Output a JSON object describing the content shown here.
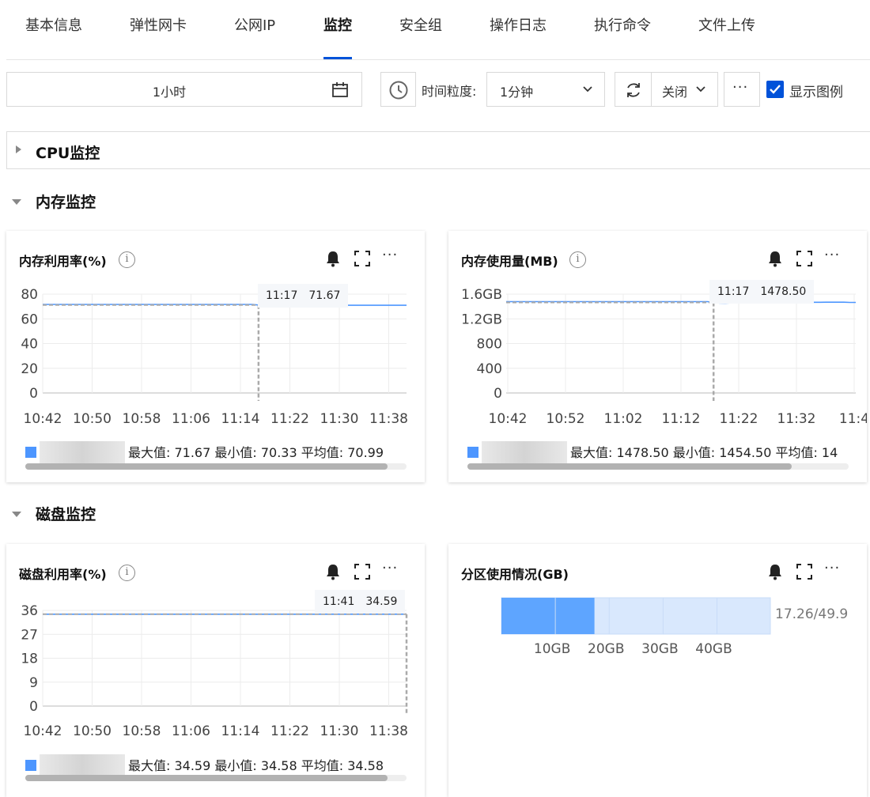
{
  "tabs": [
    {
      "label": "基本信息",
      "active": false
    },
    {
      "label": "弹性网卡",
      "active": false
    },
    {
      "label": "公网IP",
      "active": false
    },
    {
      "label": "监控",
      "active": true
    },
    {
      "label": "安全组",
      "active": false
    },
    {
      "label": "操作日志",
      "active": false
    },
    {
      "label": "执行命令",
      "active": false
    },
    {
      "label": "文件上传",
      "active": false
    }
  ],
  "toolbar": {
    "time_range": "1小时",
    "granularity_label": "时间粒度:",
    "granularity_value": "1分钟",
    "auto_refresh_value": "关闭",
    "more_label": "···",
    "show_legend_label": "显示图例",
    "show_legend_checked": true
  },
  "sections": {
    "cpu": {
      "title": "CPU监控",
      "expanded": false
    },
    "memory": {
      "title": "内存监控",
      "expanded": true
    },
    "disk": {
      "title": "磁盘监控",
      "expanded": true
    }
  },
  "colors": {
    "accent": "#0052d9",
    "series": "#4d96ff",
    "partition_fill": "#5ea5ff",
    "partition_bg": "#d9e8fd"
  },
  "cards": {
    "mem_util": {
      "title": "内存利用率(%)",
      "tooltip_time": "11:17",
      "tooltip_value": "71.67",
      "legend_stats": "最大值: 71.67 最小值: 70.33 平均值: 70.99",
      "scroll_fraction": 0.95
    },
    "mem_used": {
      "title": "内存使用量(MB)",
      "tooltip_time": "11:17",
      "tooltip_value": "1478.50",
      "legend_stats": "最大值: 1478.50 最小值: 1454.50 平均值: 14",
      "scroll_fraction": 0.85
    },
    "disk_util": {
      "title": "磁盘利用率(%)",
      "tooltip_time": "11:41",
      "tooltip_value": "34.59",
      "legend_stats": "最大值: 34.59 最小值: 34.58 平均值: 34.58",
      "scroll_fraction": 0.95
    },
    "partition": {
      "title": "分区使用情况(GB)",
      "used_label": "17.26/49.9"
    }
  },
  "chart_data": [
    {
      "id": "mem_util",
      "type": "line",
      "title": "内存利用率(%)",
      "ylim": [
        0,
        80
      ],
      "y_ticks": [
        "80",
        "60",
        "40",
        "20",
        "0"
      ],
      "x_ticks": [
        "10:42",
        "10:50",
        "10:58",
        "11:06",
        "11:14",
        "11:22",
        "11:30",
        "11:38"
      ],
      "series": [
        {
          "values": [
            71.67,
            71.67,
            71.67,
            71.67,
            71.67,
            71.67,
            71.67,
            71.67,
            71.67,
            71.67,
            71.67,
            71.67,
            71.67,
            71.67,
            71.67,
            71.67,
            71.67,
            71.67,
            71.67,
            71.67,
            71.67,
            71.67,
            71.67,
            71.67,
            71.67,
            71.67,
            71.67,
            71.67,
            71.67,
            71.67,
            71.67,
            71.67,
            71.67,
            71.67,
            71.67,
            71.2,
            70.5,
            70.33,
            70.8,
            71.0,
            71.0,
            70.9,
            71.0,
            71.0,
            70.95,
            71.0,
            71.0,
            70.9,
            71.0,
            71.0,
            71.0,
            70.95,
            71.0,
            71.0,
            71.0,
            71.0,
            71.0,
            71.0,
            71.0,
            71.0
          ]
        }
      ],
      "hover_index": 35,
      "grid": true
    },
    {
      "id": "mem_used",
      "type": "line",
      "title": "内存使用量(MB)",
      "ylim": [
        0,
        1600
      ],
      "y_ticks": [
        "1.6GB",
        "1.2GB",
        "800",
        "400",
        "0"
      ],
      "x_ticks": [
        "10:42",
        "10:52",
        "11:02",
        "11:12",
        "11:22",
        "11:32",
        "11:4"
      ],
      "series": [
        {
          "values": [
            1478.5,
            1478.5,
            1478.5,
            1478.5,
            1478.5,
            1478.5,
            1478.5,
            1478.5,
            1478.5,
            1478.5,
            1478.5,
            1478.5,
            1478.5,
            1478.5,
            1478.5,
            1478.5,
            1478.5,
            1478.5,
            1478.5,
            1478.5,
            1478.5,
            1478.5,
            1478.5,
            1478.5,
            1478.5,
            1478.5,
            1478.5,
            1478.5,
            1478.5,
            1478.5,
            1478.5,
            1478.5,
            1478.5,
            1478.5,
            1478.5,
            1465,
            1456,
            1454.5,
            1458,
            1460,
            1461,
            1462,
            1462,
            1463,
            1463,
            1464,
            1465,
            1466,
            1466,
            1467,
            1467,
            1468,
            1468,
            1468,
            1469,
            1469,
            1469,
            1469,
            1466,
            1465
          ]
        }
      ],
      "hover_index": 35,
      "grid": true
    },
    {
      "id": "disk_util",
      "type": "line",
      "title": "磁盘利用率(%)",
      "ylim": [
        0,
        36
      ],
      "y_ticks": [
        "36",
        "27",
        "18",
        "9",
        "0"
      ],
      "x_ticks": [
        "10:42",
        "10:50",
        "10:58",
        "11:06",
        "11:14",
        "11:22",
        "11:30",
        "11:38"
      ],
      "series": [
        {
          "values": [
            34.58,
            34.58,
            34.58,
            34.58,
            34.58,
            34.58,
            34.58,
            34.58,
            34.58,
            34.58,
            34.58,
            34.58,
            34.58,
            34.58,
            34.58,
            34.58,
            34.58,
            34.58,
            34.58,
            34.58,
            34.58,
            34.58,
            34.58,
            34.58,
            34.58,
            34.58,
            34.58,
            34.58,
            34.58,
            34.58,
            34.58,
            34.58,
            34.58,
            34.58,
            34.58,
            34.58,
            34.58,
            34.58,
            34.58,
            34.58,
            34.58,
            34.58,
            34.58,
            34.58,
            34.58,
            34.58,
            34.58,
            34.58,
            34.58,
            34.58,
            34.58,
            34.58,
            34.58,
            34.58,
            34.58,
            34.58,
            34.58,
            34.58,
            34.58,
            34.59
          ]
        }
      ],
      "hover_index": 59,
      "grid": true
    },
    {
      "id": "partition",
      "type": "bar",
      "title": "分区使用情况(GB)",
      "orientation": "horizontal",
      "used": 17.26,
      "total": 49.9,
      "x_ticks": [
        "10GB",
        "20GB",
        "30GB",
        "40GB"
      ],
      "x_tick_values": [
        10,
        20,
        30,
        40
      ]
    }
  ]
}
